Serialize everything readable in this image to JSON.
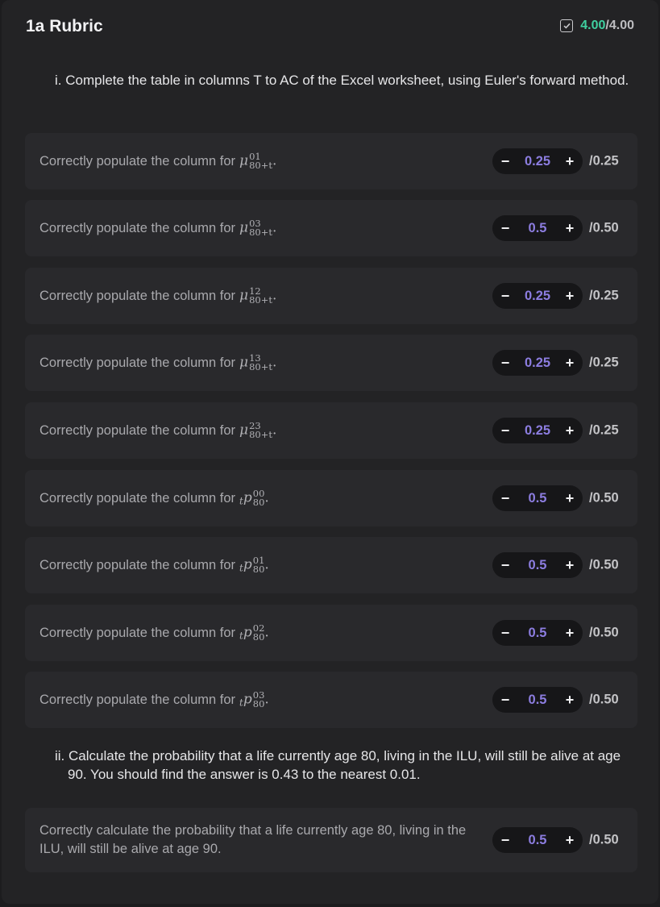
{
  "header": {
    "title": "1a Rubric",
    "score_earned": "4.00",
    "score_sep": "/",
    "score_total": "4.00"
  },
  "sections": [
    {
      "question": "i. Complete the table in columns T to AC of the Excel worksheet, using Euler's forward method.",
      "criteria": [
        {
          "text": "Correctly populate the column for",
          "sym": "μ",
          "sup": "01",
          "sub": "80+t",
          "pre": "",
          "value": "0.25",
          "max": "/0.25"
        },
        {
          "text": "Correctly populate the column for",
          "sym": "μ",
          "sup": "03",
          "sub": "80+t",
          "pre": "",
          "value": "0.5",
          "max": "/0.50"
        },
        {
          "text": "Correctly populate the column for",
          "sym": "μ",
          "sup": "12",
          "sub": "80+t",
          "pre": "",
          "value": "0.25",
          "max": "/0.25"
        },
        {
          "text": "Correctly populate the column for",
          "sym": "μ",
          "sup": "13",
          "sub": "80+t",
          "pre": "",
          "value": "0.25",
          "max": "/0.25"
        },
        {
          "text": "Correctly populate the column for",
          "sym": "μ",
          "sup": "23",
          "sub": "80+t",
          "pre": "",
          "value": "0.25",
          "max": "/0.25"
        },
        {
          "text": "Correctly populate the column for",
          "sym": "p",
          "sup": "00",
          "sub": "80",
          "pre": "t",
          "value": "0.5",
          "max": "/0.50"
        },
        {
          "text": "Correctly populate the column for",
          "sym": "p",
          "sup": "01",
          "sub": "80",
          "pre": "t",
          "value": "0.5",
          "max": "/0.50"
        },
        {
          "text": "Correctly populate the column for",
          "sym": "p",
          "sup": "02",
          "sub": "80",
          "pre": "t",
          "value": "0.5",
          "max": "/0.50"
        },
        {
          "text": "Correctly populate the column for",
          "sym": "p",
          "sup": "03",
          "sub": "80",
          "pre": "t",
          "value": "0.5",
          "max": "/0.50"
        }
      ]
    },
    {
      "question": "ii. Calculate the probability that a life currently age 80, living in the ILU, will still be alive at age 90. You should find the answer is 0.43 to the nearest 0.01.",
      "criteria": [
        {
          "text": "Correctly calculate the probability that a life currently age 80, living in the ILU, will still be alive at age 90.",
          "value": "0.5",
          "max": "/0.50"
        }
      ]
    }
  ],
  "stepper": {
    "minus": "−",
    "plus": "+"
  },
  "colors": {
    "accent": "#8c7de0",
    "earned": "#3fd0a0"
  }
}
